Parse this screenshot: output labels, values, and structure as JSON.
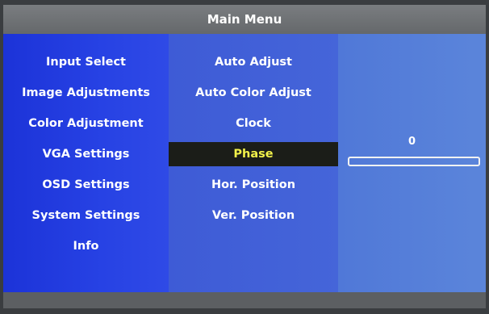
{
  "title": "Main Menu",
  "main_menu": [
    "Input Select",
    "Image Adjustments",
    "Color Adjustment",
    "VGA Settings",
    "OSD Settings",
    "System Settings",
    "Info"
  ],
  "submenu": [
    "Auto Adjust",
    "Auto Color Adjust",
    "Clock",
    "Phase",
    "Hor. Position",
    "Ver. Position"
  ],
  "selected_submenu": "Phase",
  "value": {
    "label": "0",
    "fraction": 0
  },
  "colors": {
    "highlight_text": "#f2f24a",
    "highlight_bg": "#1b1d18",
    "left_panel": "#2742e4",
    "mid_panel": "#4565d9",
    "right_panel": "#5b85da"
  }
}
